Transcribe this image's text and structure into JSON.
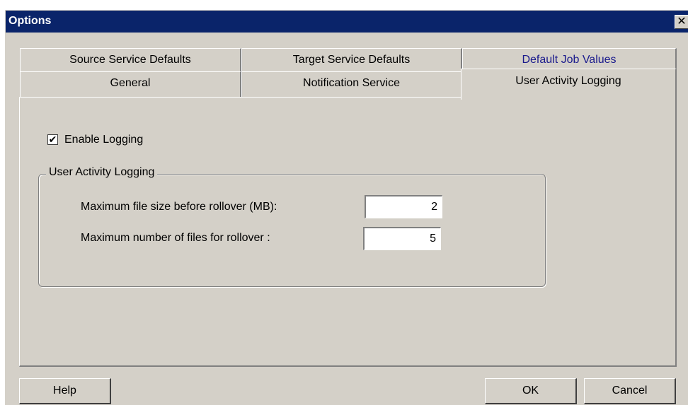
{
  "window": {
    "title": "Options",
    "close_glyph": "✕"
  },
  "tabs": {
    "back_row": [
      {
        "label": "Source Service Defaults"
      },
      {
        "label": "Target Service Defaults"
      },
      {
        "label": "Default Job Values"
      }
    ],
    "front_row": [
      {
        "label": "General"
      },
      {
        "label": "Notification Service"
      },
      {
        "label": "User Activity Logging",
        "active": true
      }
    ]
  },
  "panel": {
    "enable_logging": {
      "label": "Enable Logging",
      "checked": true,
      "check_glyph": "✔"
    },
    "group": {
      "title": "User Activity Logging",
      "max_file_size": {
        "label": "Maximum file size before rollover (MB):",
        "value": "2"
      },
      "max_files": {
        "label": "Maximum number of files for rollover :",
        "value": "5"
      }
    }
  },
  "buttons": {
    "help": "Help",
    "ok": "OK",
    "cancel": "Cancel"
  },
  "colors": {
    "titlebar": "#0a246a",
    "dialog_face": "#d4d0c8",
    "highlight_tab_text": "#1a1a8c"
  }
}
